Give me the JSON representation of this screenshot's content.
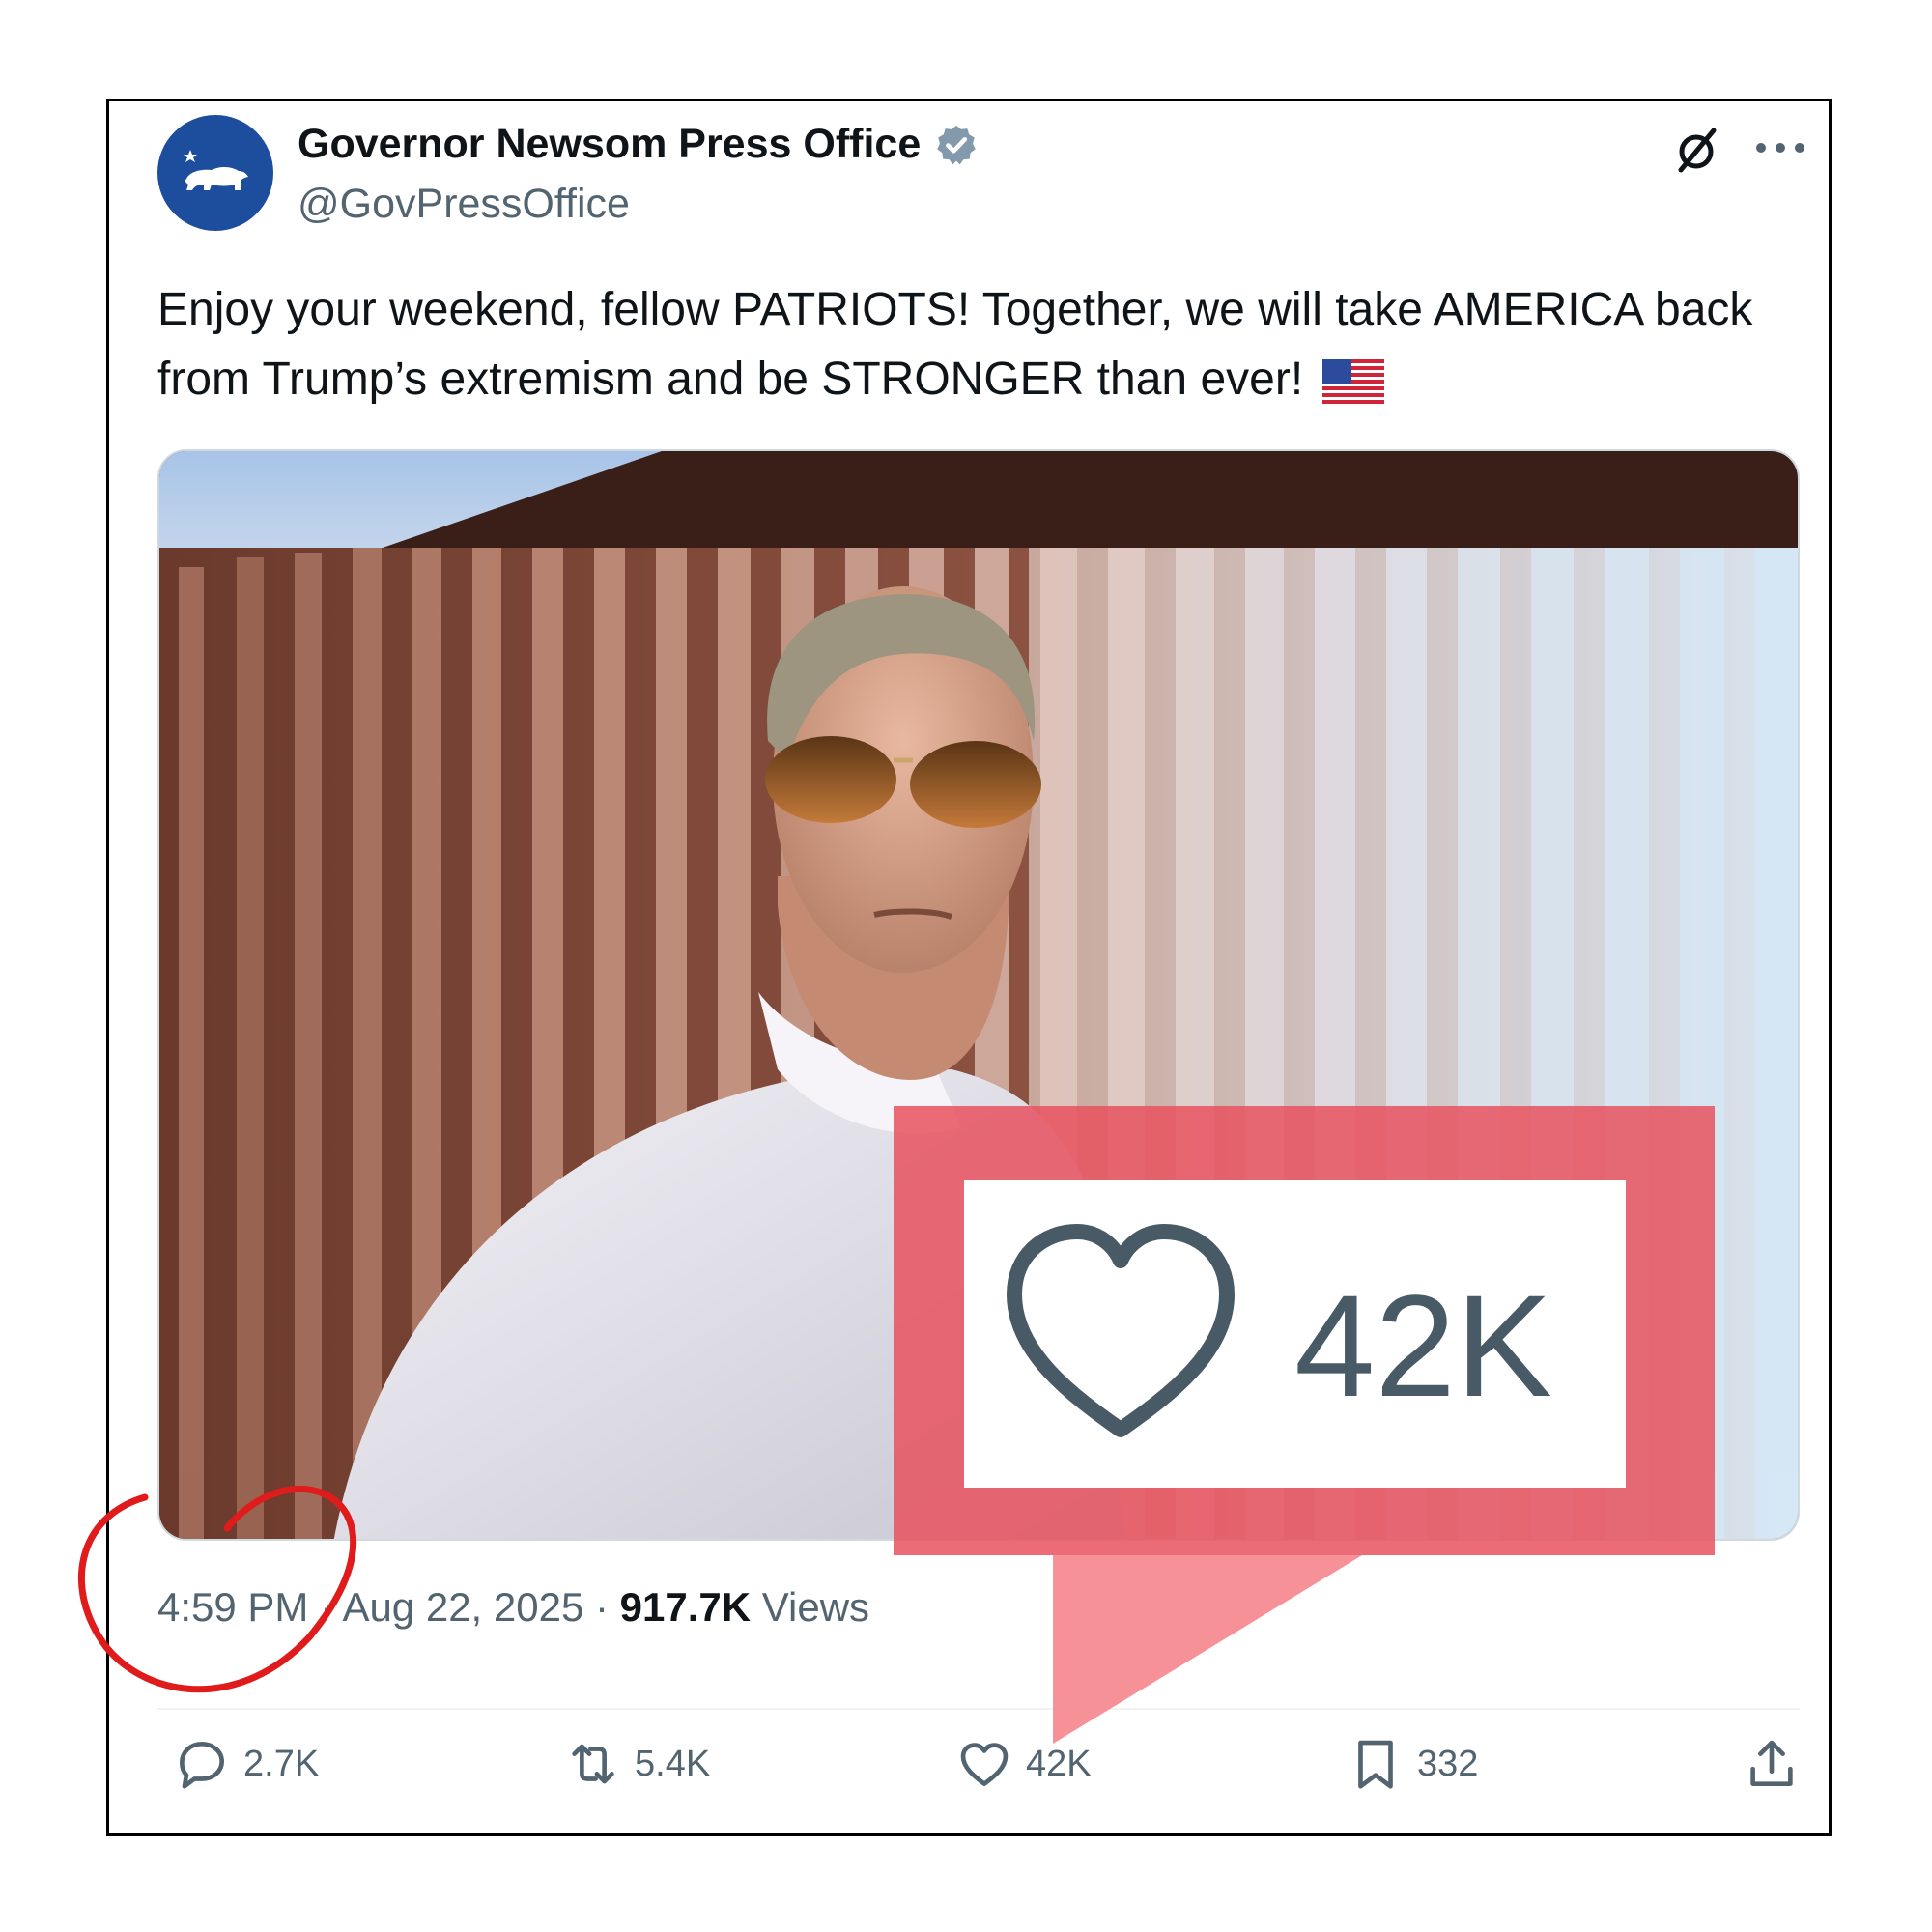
{
  "author": {
    "display_name": "Governor Newsom Press Office",
    "handle": "@GovPressOffice",
    "verified": true
  },
  "tweet": {
    "text": "Enjoy your weekend, fellow PATRIOTS! Together, we will take AMERICA back from Trump’s extremism and be STRONGER than ever!",
    "emoji": "us-flag-emoji",
    "time": "4:59 PM",
    "date": "Aug 22, 2025",
    "views_count": "917.7K",
    "views_label": "Views",
    "separator": " · "
  },
  "actions": {
    "replies": "2.7K",
    "reposts": "5.4K",
    "likes": "42K",
    "bookmarks": "332"
  },
  "callout": {
    "likes_zoom": "42K",
    "color": "#e8525f"
  },
  "colors": {
    "text": "#0f1419",
    "secondary": "#536471",
    "verified": "#829aab",
    "annotation_circle": "#e01b1b"
  }
}
